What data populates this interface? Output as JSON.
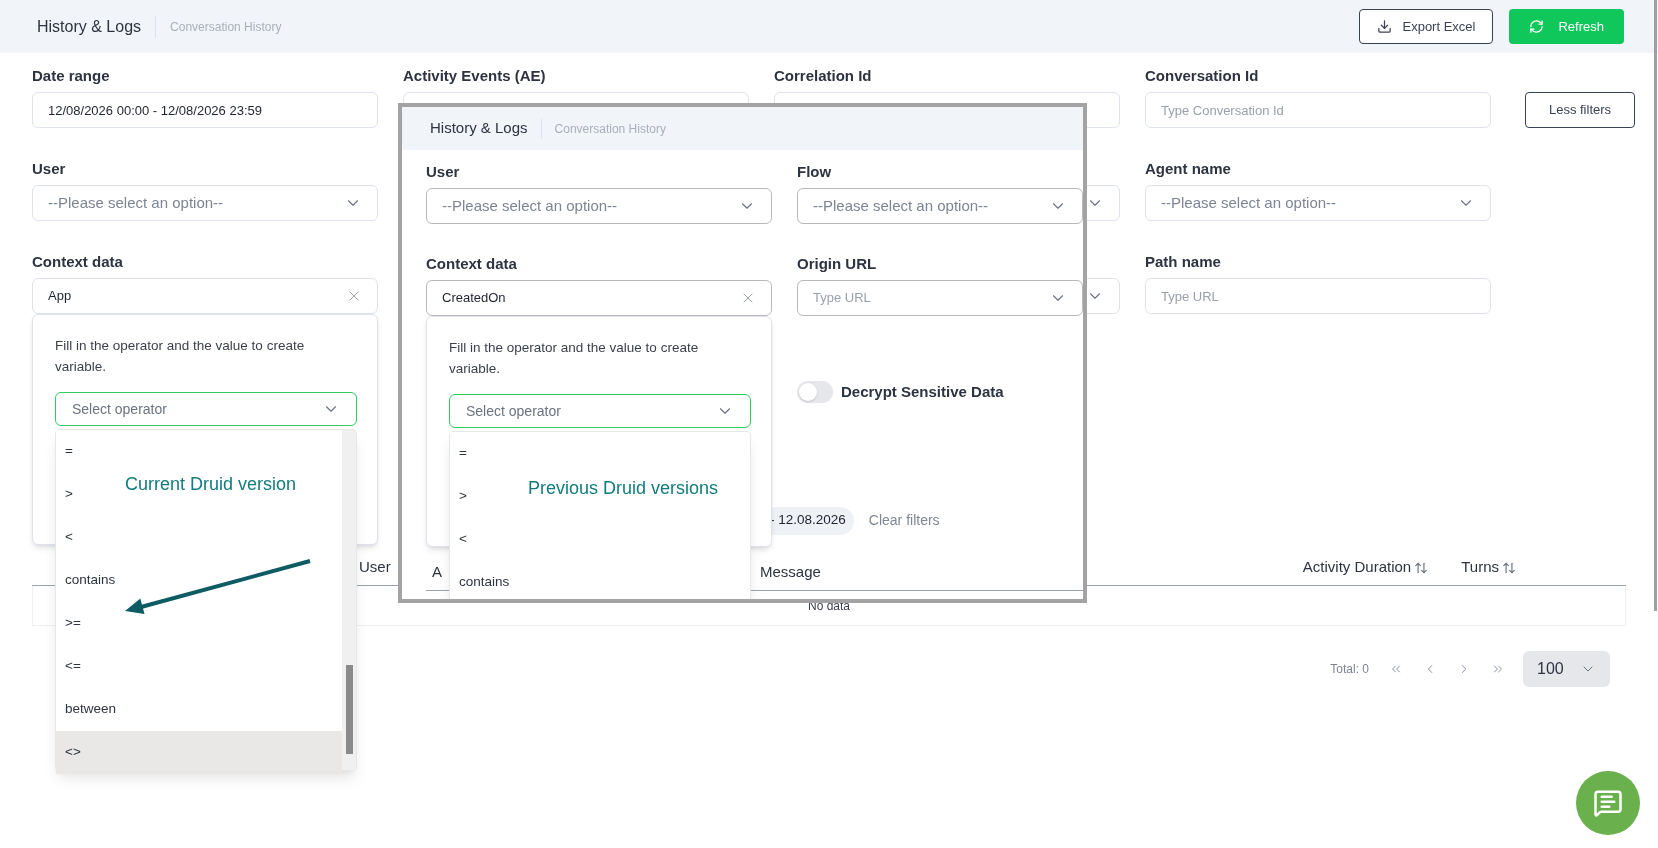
{
  "header": {
    "title": "History & Logs",
    "subtitle": "Conversation History",
    "buttons": [
      {
        "label": "Export Excel",
        "kind": "outline"
      },
      {
        "label": "Refresh",
        "kind": "primary"
      }
    ]
  },
  "filters": {
    "row1": [
      {
        "label": "Date range",
        "kind": "input",
        "value": "12/08/2026 00:00 - 12/08/2026 23:59"
      },
      {
        "label": "Activity Events (AE)",
        "kind": "input"
      },
      {
        "label": "Correlation Id",
        "kind": "input"
      },
      {
        "label": "Conversation Id",
        "kind": "input",
        "placeholder": "Type Conversation Id"
      }
    ],
    "less_filters": "Less filters",
    "row2": [
      {
        "label": "User",
        "kind": "select",
        "placeholder": "--Please select an option--"
      },
      {
        "kind": "select"
      },
      {
        "label": "Agent name",
        "kind": "select",
        "placeholder": "--Please select an option--"
      }
    ],
    "row3": [
      {
        "label": "Context data",
        "kind": "clearable",
        "value": "App"
      },
      {
        "kind": "select"
      },
      {
        "label": "Path name",
        "kind": "input",
        "placeholder": "Type URL"
      }
    ]
  },
  "operator_popup": {
    "hint": "Fill in the operator and the value to create variable.",
    "select_placeholder": "Select operator",
    "options": [
      {
        "label": "=",
        "highlighted": false
      },
      {
        "label": ">",
        "highlighted": false
      },
      {
        "label": "<",
        "highlighted": false
      },
      {
        "label": "contains",
        "highlighted": false
      },
      {
        "label": ">=",
        "highlighted": false
      },
      {
        "label": "<=",
        "highlighted": false
      },
      {
        "label": "between",
        "highlighted": false
      },
      {
        "label": "<>",
        "highlighted": true
      }
    ]
  },
  "annotation": "Current Druid version",
  "table": {
    "columns": [
      {
        "label": "User",
        "sortable": false
      },
      {
        "label": "Activity Duration",
        "sortable": true
      },
      {
        "label": "Turns",
        "sortable": true
      }
    ],
    "empty_text": "No data"
  },
  "pagination": {
    "total": "Total: 0",
    "page_size": "100"
  },
  "inset": {
    "title": "History & Logs",
    "subtitle": "Conversation History",
    "row1": [
      {
        "label": "User",
        "kind": "select",
        "placeholder": "--Please select an option--"
      },
      {
        "label": "Flow",
        "kind": "select",
        "placeholder": "--Please select an option--"
      }
    ],
    "row2": [
      {
        "label": "Context data",
        "kind": "clearable",
        "value": "CreatedOn"
      },
      {
        "label": "Origin URL",
        "kind": "combo",
        "placeholder": "Type URL"
      }
    ],
    "operator_popup": {
      "hint": "Fill in the operator and the value to create variable.",
      "select_placeholder": "Select operator",
      "options": [
        {
          "label": "=",
          "highlighted": false
        },
        {
          "label": ">",
          "highlighted": false
        },
        {
          "label": "<",
          "highlighted": false
        },
        {
          "label": "contains",
          "highlighted": false
        }
      ]
    },
    "toggle": {
      "label": "Decrypt Sensitive Data",
      "on": false
    },
    "date_chip": "- 12.08.2026",
    "clear_filters": "Clear filters",
    "columns": [
      "A",
      "Message"
    ],
    "annotation": "Previous Druid versions"
  }
}
